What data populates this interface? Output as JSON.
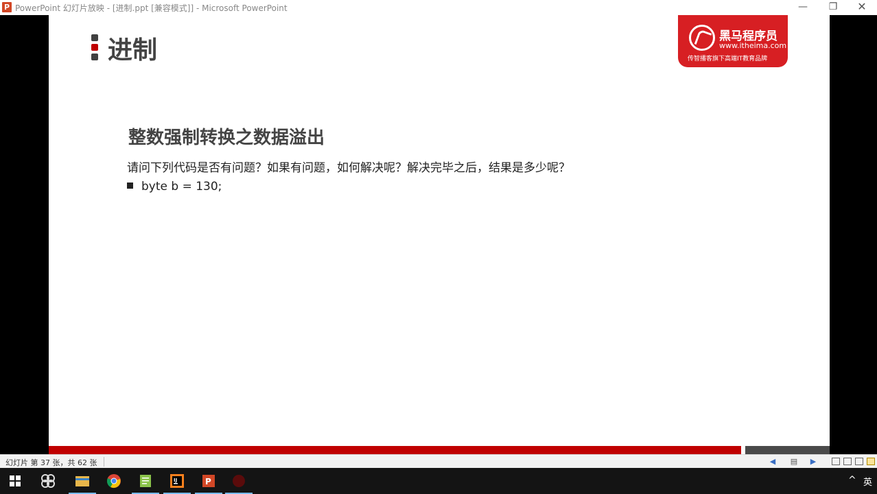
{
  "window": {
    "app_icon_letter": "P",
    "title": "PowerPoint 幻灯片放映 - [进制.ppt [兼容模式]] - Microsoft PowerPoint",
    "minimize_glyph": "—",
    "restore_glyph": "❐",
    "close_glyph": "✕"
  },
  "slide": {
    "title": "进制",
    "marker_colors": [
      "#404040",
      "#c00000",
      "#404040"
    ],
    "logo": {
      "name": "黑马程序员",
      "url": "www.itheima.com",
      "slogan": "传智播客旗下高端IT教育品牌",
      "color": "#d71f23"
    },
    "subheading": "整数强制转换之数据溢出",
    "question": "请问下列代码是否有问题？如果有问题，如何解决呢？解决完毕之后，结果是多少呢？",
    "bullet": "byte b = 130;",
    "footer_colors": [
      "#c00000",
      "#4a4a4a"
    ]
  },
  "statusbar": {
    "slide_info": "幻灯片 第 37 张，共 62 张"
  },
  "taskbar": {
    "items": [
      "start",
      "task-view",
      "file-explorer",
      "chrome",
      "notepad",
      "intellij-idea",
      "powerpoint",
      "recorder"
    ],
    "tray_caret": "^",
    "ime": "英"
  }
}
